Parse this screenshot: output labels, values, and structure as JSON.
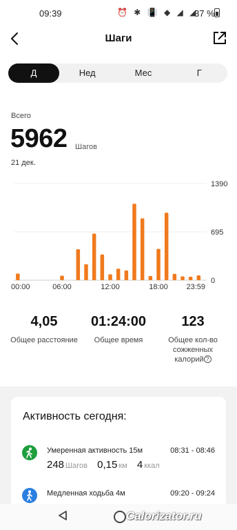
{
  "status_bar": {
    "time": "09:39",
    "icons": "⏰ ✱ 📳 ◆ ◢ ◢",
    "battery": "37 %"
  },
  "header": {
    "title": "Шаги",
    "back_icon": "back-chevron",
    "share_icon": "share-export"
  },
  "period_tabs": [
    {
      "label": "Д",
      "active": true
    },
    {
      "label": "Нед",
      "active": false
    },
    {
      "label": "Мес",
      "active": false
    },
    {
      "label": "Г",
      "active": false
    }
  ],
  "summary": {
    "total_label": "Всего",
    "total_value": "5962",
    "total_unit": "Шагов",
    "date": "21 дек."
  },
  "chart_data": {
    "type": "bar",
    "color": "#f07a1e",
    "x_tick_labels": [
      "00:00",
      "06:00",
      "12:00",
      "18:00",
      "23:59"
    ],
    "y_tick_labels": [
      "1390",
      "695",
      "0"
    ],
    "ylim": [
      0,
      1390
    ],
    "grid": true,
    "bars": [
      {
        "hour": 0.5,
        "value": 95
      },
      {
        "hour": 6.0,
        "value": 65
      },
      {
        "hour": 8.0,
        "value": 445
      },
      {
        "hour": 9.0,
        "value": 230
      },
      {
        "hour": 10.0,
        "value": 670
      },
      {
        "hour": 11.0,
        "value": 370
      },
      {
        "hour": 12.0,
        "value": 85
      },
      {
        "hour": 13.0,
        "value": 165
      },
      {
        "hour": 14.0,
        "value": 140
      },
      {
        "hour": 15.0,
        "value": 1100
      },
      {
        "hour": 16.0,
        "value": 890
      },
      {
        "hour": 17.0,
        "value": 60
      },
      {
        "hour": 18.0,
        "value": 450
      },
      {
        "hour": 19.0,
        "value": 970
      },
      {
        "hour": 20.0,
        "value": 90
      },
      {
        "hour": 21.0,
        "value": 55
      },
      {
        "hour": 22.0,
        "value": 50
      },
      {
        "hour": 23.0,
        "value": 70
      }
    ]
  },
  "stats": [
    {
      "value": "4,05",
      "label": "Общее расстояние"
    },
    {
      "value": "01:24:00",
      "label": "Общее время"
    },
    {
      "value": "123",
      "label_lines": [
        "Общее кол-во",
        "сожженных",
        "калорий"
      ]
    }
  ],
  "activity": {
    "title": "Активность сегодня:",
    "items": [
      {
        "name": "Умеренная активность 15м",
        "time": "08:31 - 08:46",
        "steps": "248",
        "steps_unit": "Шагов",
        "distance": "0,15",
        "distance_unit": "км",
        "calories": "4",
        "calories_unit": "ккал",
        "icon": "walking-person",
        "icon_color": "#1e9e3e"
      },
      {
        "name": "Медленная ходьба 4м",
        "time": "09:20 - 09:24",
        "icon": "slow-walk-person",
        "icon_color": "#2a7fe0"
      }
    ]
  },
  "watermark": "Calorizator.ru"
}
